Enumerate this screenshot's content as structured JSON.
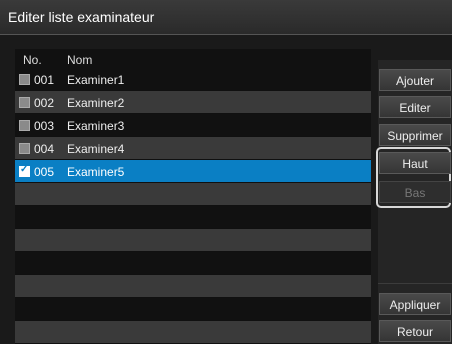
{
  "window": {
    "title": "Editer liste examinateur"
  },
  "list": {
    "headers": {
      "no": "No.",
      "name": "Nom"
    },
    "rows": [
      {
        "no": "001",
        "name": "Examiner1",
        "checked": false
      },
      {
        "no": "002",
        "name": "Examiner2",
        "checked": false
      },
      {
        "no": "003",
        "name": "Examiner3",
        "checked": false
      },
      {
        "no": "004",
        "name": "Examiner4",
        "checked": false
      },
      {
        "no": "005",
        "name": "Examiner5",
        "checked": true
      }
    ],
    "check_glyph": "✓"
  },
  "buttons": {
    "add": "Ajouter",
    "edit": "Editer",
    "delete": "Supprimer",
    "up": "Haut",
    "down": "Bas",
    "apply": "Appliquer",
    "back": "Retour"
  },
  "colors": {
    "selection": "#0a7fc4"
  }
}
